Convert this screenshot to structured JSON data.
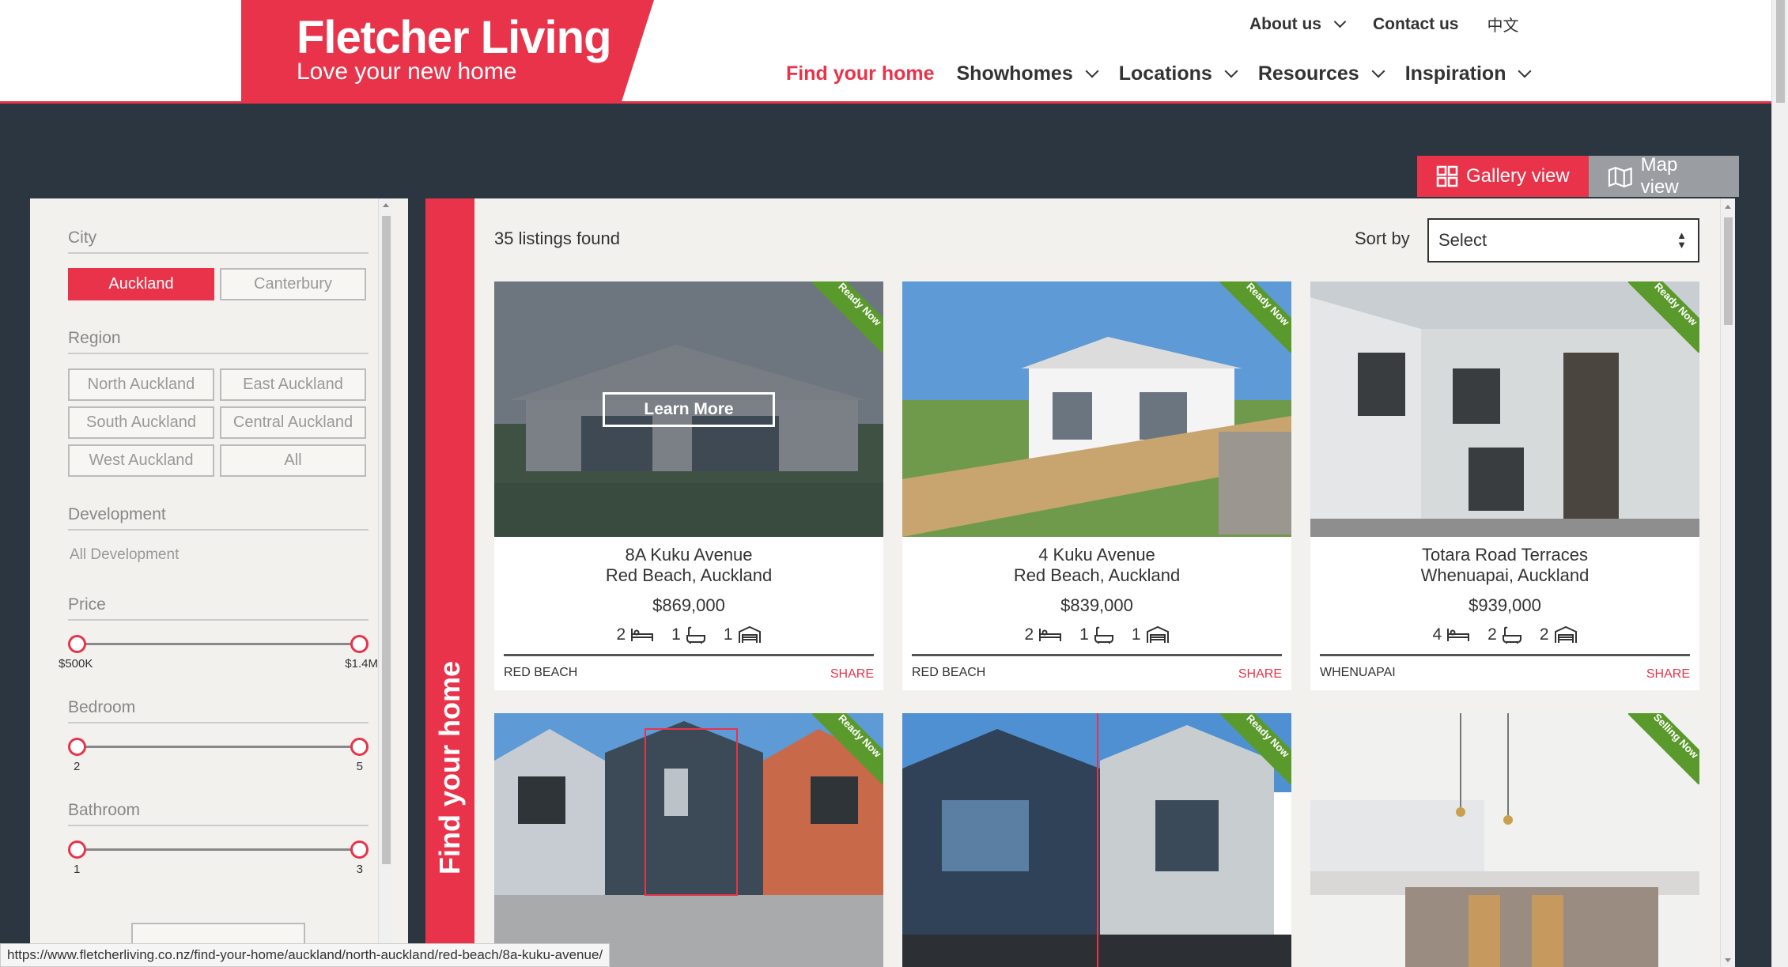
{
  "brand": {
    "name": "Fletcher Living",
    "tagline": "Love your new home"
  },
  "top_nav": [
    {
      "label": "About us",
      "dropdown": true
    },
    {
      "label": "Contact us",
      "dropdown": false
    },
    {
      "label": "中文",
      "dropdown": false
    }
  ],
  "main_nav": [
    {
      "label": "Find your home",
      "dropdown": false,
      "active": true
    },
    {
      "label": "Showhomes",
      "dropdown": true
    },
    {
      "label": "Locations",
      "dropdown": true
    },
    {
      "label": "Resources",
      "dropdown": true
    },
    {
      "label": "Inspiration",
      "dropdown": true
    }
  ],
  "view_toggle": {
    "gallery": "Gallery view",
    "map": "Map view",
    "active": "gallery"
  },
  "filters": {
    "city": {
      "label": "City",
      "options": [
        "Auckland",
        "Canterbury"
      ],
      "selected": "Auckland"
    },
    "region": {
      "label": "Region",
      "options": [
        "North Auckland",
        "East Auckland",
        "South Auckland",
        "Central Auckland",
        "West Auckland",
        "All"
      ]
    },
    "development": {
      "label": "Development",
      "value": "All Development"
    },
    "price": {
      "label": "Price",
      "min": "$500K",
      "max": "$1.4M"
    },
    "bedroom": {
      "label": "Bedroom",
      "min": "2",
      "max": "5"
    },
    "bathroom": {
      "label": "Bathroom",
      "min": "1",
      "max": "3"
    }
  },
  "vertical_tab": "Find your home",
  "results": {
    "count_text": "35 listings found",
    "sort_label": "Sort by",
    "sort_value": "Select"
  },
  "listings": [
    {
      "street": "8A Kuku Avenue",
      "locality": "Red Beach, Auckland",
      "price": "$869,000",
      "beds": "2",
      "baths": "1",
      "garages": "1",
      "suburb": "RED BEACH",
      "badge": "Ready Now",
      "hover": true,
      "learn_more": "Learn More"
    },
    {
      "street": "4 Kuku Avenue",
      "locality": "Red Beach, Auckland",
      "price": "$839,000",
      "beds": "2",
      "baths": "1",
      "garages": "1",
      "suburb": "RED BEACH",
      "badge": "Ready Now"
    },
    {
      "street": "Totara Road Terraces",
      "locality": "Whenuapai, Auckland",
      "price": "$939,000",
      "beds": "4",
      "baths": "2",
      "garages": "2",
      "suburb": "WHENUAPAI",
      "badge": "Ready Now"
    },
    {
      "badge": "Ready Now"
    },
    {
      "badge": "Ready Now"
    },
    {
      "badge": "Selling Now"
    }
  ],
  "share_label": "SHARE",
  "status_url": "https://www.fletcherliving.co.nz/find-your-home/auckland/north-auckland/red-beach/8a-kuku-avenue/",
  "colors": {
    "brand_red": "#e8334a",
    "dark_band": "#2b3640",
    "ribbon_green": "#5a9a2c"
  }
}
